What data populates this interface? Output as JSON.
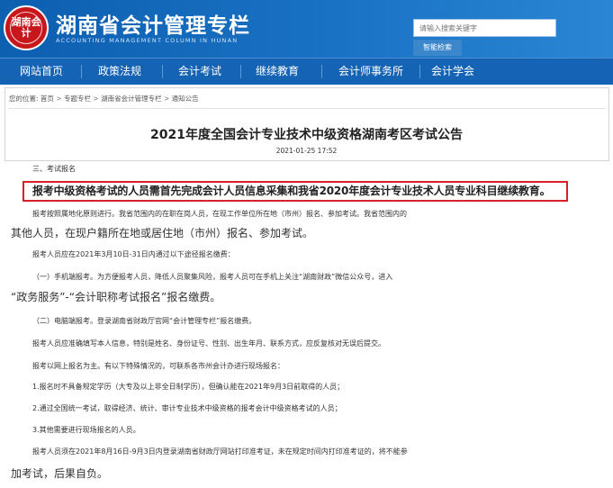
{
  "header": {
    "logo_text": "湖南会计",
    "title": "湖南省会计管理专栏",
    "subtitle": "ACCOUNTING MANAGEMENT COLUMN IN HUNAN",
    "search_placeholder": "请输入搜索关键字",
    "search_button": "智能检索",
    "bg_color": "#1563b4",
    "logo_color": "#c8161d"
  },
  "nav": {
    "items": [
      {
        "label": "网站首页"
      },
      {
        "label": "政策法规"
      },
      {
        "label": "会计考试"
      },
      {
        "label": "继续教育"
      },
      {
        "label": "会计师事务所"
      },
      {
        "label": "会计学会"
      }
    ]
  },
  "breadcrumb": {
    "prefix": "您的位置:",
    "items": [
      "首页",
      "专题专栏",
      "湖南省会计管理专栏",
      "通知公告"
    ],
    "separator": ">"
  },
  "article": {
    "title": "2021年度全国会计专业技术中级资格湖南考区考试公告",
    "date": "2021-01-25 17:52",
    "highlight_color": "#d6212a",
    "paragraphs": [
      "三、考试报名",
      "报考中级资格考试的人员需首先完成会计人员信息采集和我省2020年度会计专业技术人员专业科目继续教育。",
      "报考按照属地化原则进行。我省范围内的在职在岗人员，在现工作单位所在地（市州）报名、参加考试。我省范围内的",
      "其他人员，在现户籍所在地或居住地（市州）报名、参加考试。",
      "报考人员应在2021年3月10日-31日内通过以下途径报名缴费：",
      "（一）手机端报考。为方便报考人员，降低人员聚集风险，报考人员可在手机上关注“湖南财政”微信公众号，进入",
      "“政务服务”-“会计职称考试报名”报名缴费。",
      "（二）电脑端报考。登录湖南省财政厅官网“会计管理专栏”报名缴费。",
      "报考人员应准确填写本人信息，特别是姓名、身份证号、性别、出生年月、联系方式，应反复核对无误后提交。",
      "报考以网上报名为主。有以下特殊情况的，可联系各市州会计办进行现场报名：",
      "1.报名时不具备规定学历（大专及以上非全日制学历），但确认能在2021年9月3日前取得的人员；",
      "2.通过全国统一考试，取得经济、统计、审计专业技术中级资格的报考会计中级资格考试的人员；",
      "3.其他需要进行现场报名的人员。",
      "报考人员须在2021年8月16日-9月3日内登录湖南省财政厅网站打印准考证，未在规定时间内打印准考证的，将不能参",
      "加考试，后果自负。"
    ]
  }
}
